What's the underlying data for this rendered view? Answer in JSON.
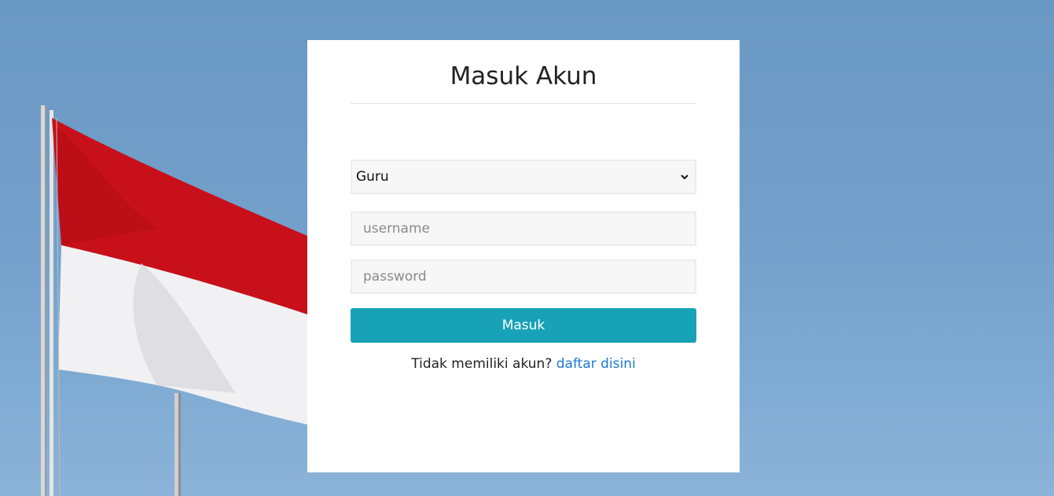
{
  "login": {
    "title": "Masuk Akun",
    "role_select": {
      "selected": "Guru"
    },
    "username": {
      "value": "",
      "placeholder": "username"
    },
    "password": {
      "value": "",
      "placeholder": "password"
    },
    "submit_label": "Masuk",
    "register_prompt": "Tidak memiliki akun?",
    "register_link": "daftar disini"
  },
  "colors": {
    "accent": "#18a2b8",
    "link": "#1e78d0",
    "flag_red": "#c8101a",
    "flag_white": "#f2f2f2"
  }
}
